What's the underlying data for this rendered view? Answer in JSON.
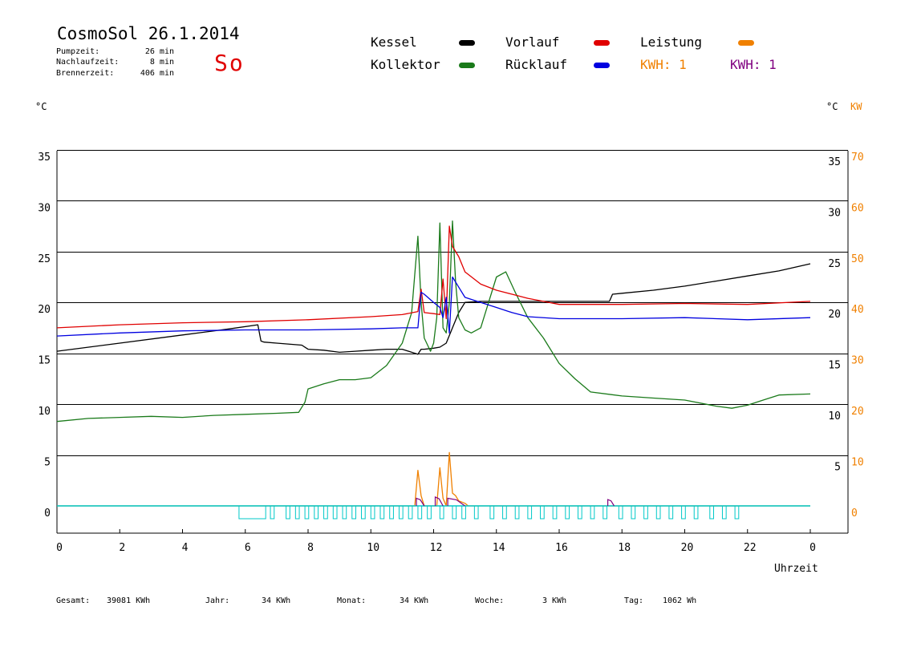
{
  "header": {
    "title": "CosmoSol 26.1.2014",
    "day": "So",
    "day_color": "#e00000",
    "stats": [
      {
        "label": "Pumpzeit:",
        "value": "26 min"
      },
      {
        "label": "Nachlaufzeit:",
        "value": "8 min"
      },
      {
        "label": "Brennerzeit:",
        "value": "406 min"
      }
    ]
  },
  "legend": {
    "kessel": {
      "label": "Kessel",
      "color": "#000000"
    },
    "kollektor": {
      "label": "Kollektor",
      "color": "#1a7a1a"
    },
    "vorlauf": {
      "label": "Vorlauf",
      "color": "#e00000"
    },
    "ruecklauf": {
      "label": "Rücklauf",
      "color": "#0000e0"
    },
    "leistung": {
      "label": "Leistung",
      "color": "#f08000"
    },
    "kwh_orange": {
      "label": "KWH: 1",
      "color": "#f08000"
    },
    "kwh_purple": {
      "label": "KWH: 1",
      "color": "#800080"
    }
  },
  "axes": {
    "left_unit": "°C",
    "right_unit": "°C",
    "kw_unit": "KW",
    "xlabel": "Uhrzeit"
  },
  "footer": [
    {
      "label": "Gesamt:",
      "value": "39081 KWh"
    },
    {
      "label": "Jahr:",
      "value": "34 KWh"
    },
    {
      "label": "Monat:",
      "value": "34 KWh"
    },
    {
      "label": "Woche:",
      "value": "3 KWh"
    },
    {
      "label": "Tag:",
      "value": "1062 Wh"
    }
  ],
  "chart_data": {
    "type": "line",
    "xlim": [
      0,
      24
    ],
    "ylim": [
      -2,
      36.5
    ],
    "y_ticks_left": [
      "0",
      "5",
      "10",
      "15",
      "20",
      "25",
      "30",
      "35"
    ],
    "y_ticks_right_c": [
      "5",
      "10",
      "15",
      "20",
      "25",
      "30",
      "35"
    ],
    "y_ticks_right_kw": [
      "0",
      "10",
      "20",
      "30",
      "40",
      "50",
      "60",
      "70"
    ],
    "x_ticks": [
      "0",
      "2",
      "4",
      "6",
      "8",
      "10",
      "12",
      "14",
      "16",
      "18",
      "20",
      "22",
      "0"
    ],
    "grid": true,
    "series": [
      {
        "name": "Kessel",
        "color": "#000000",
        "x": [
          0,
          2,
          4,
          5.5,
          6.4,
          6.5,
          6.6,
          7,
          7.8,
          8,
          8.5,
          9,
          9.5,
          10,
          10.5,
          11,
          11.5,
          11.6,
          11.7,
          12,
          12.2,
          12.4,
          12.6,
          12.8,
          13,
          13.5,
          14,
          15,
          16,
          17,
          17.6,
          17.7,
          18,
          19,
          20,
          21,
          22,
          23,
          24
        ],
        "y": [
          15.2,
          16.0,
          16.8,
          17.4,
          17.8,
          16.2,
          16.1,
          16.0,
          15.8,
          15.4,
          15.3,
          15.1,
          15.2,
          15.3,
          15.4,
          15.4,
          14.9,
          15.4,
          15.4,
          15.5,
          15.6,
          16.0,
          17.5,
          19.0,
          20.0,
          20.1,
          20.1,
          20.1,
          20.1,
          20.1,
          20.1,
          20.8,
          20.9,
          21.2,
          21.6,
          22.1,
          22.6,
          23.1,
          23.8
        ]
      },
      {
        "name": "Kollektor",
        "color": "#1a7a1a",
        "x": [
          0,
          1,
          2,
          3,
          4,
          5,
          6,
          7,
          7.7,
          7.9,
          8,
          8.5,
          9,
          9.5,
          10,
          10.5,
          11,
          11.3,
          11.5,
          11.6,
          11.7,
          11.9,
          12,
          12.1,
          12.2,
          12.3,
          12.4,
          12.5,
          12.6,
          12.7,
          12.8,
          13,
          13.2,
          13.5,
          14,
          14.3,
          14.6,
          15,
          15.5,
          16,
          16.5,
          17,
          18,
          19,
          20,
          21,
          21.5,
          22,
          22.5,
          23,
          24
        ],
        "y": [
          8.3,
          8.6,
          8.7,
          8.8,
          8.7,
          8.9,
          9.0,
          9.1,
          9.2,
          10.2,
          11.5,
          12.0,
          12.4,
          12.4,
          12.6,
          13.8,
          16.0,
          19.0,
          26.5,
          20.0,
          16.5,
          15.2,
          16.0,
          18.5,
          27.8,
          17.5,
          17.0,
          20.0,
          28.0,
          22.0,
          18.5,
          17.3,
          17.0,
          17.5,
          22.5,
          23.0,
          21.0,
          18.5,
          16.5,
          14.0,
          12.5,
          11.2,
          10.8,
          10.6,
          10.4,
          9.8,
          9.6,
          9.9,
          10.4,
          10.9,
          11.0
        ]
      },
      {
        "name": "Vorlauf",
        "color": "#e00000",
        "x": [
          0,
          2,
          4,
          6,
          8,
          10,
          11,
          11.5,
          11.6,
          11.7,
          12,
          12.2,
          12.3,
          12.4,
          12.5,
          12.6,
          12.8,
          13,
          13.5,
          14,
          14.5,
          15,
          15.5,
          16,
          18,
          20,
          22,
          24
        ],
        "y": [
          17.5,
          17.8,
          18.0,
          18.1,
          18.3,
          18.6,
          18.8,
          19.1,
          21.3,
          19.0,
          18.9,
          18.8,
          22.3,
          18.4,
          27.5,
          25.5,
          24.5,
          23.0,
          21.8,
          21.2,
          20.8,
          20.4,
          20.1,
          19.8,
          19.8,
          19.9,
          19.8,
          20.1
        ]
      },
      {
        "name": "Rücklauf",
        "color": "#0000e0",
        "x": [
          0,
          2,
          4,
          6,
          8,
          10,
          11,
          11.5,
          11.6,
          11.7,
          12,
          12.2,
          12.3,
          12.4,
          12.5,
          12.6,
          12.8,
          13,
          13.5,
          14,
          14.5,
          15,
          16,
          18,
          20,
          22,
          24
        ],
        "y": [
          16.7,
          17.0,
          17.2,
          17.3,
          17.3,
          17.4,
          17.5,
          17.5,
          21.0,
          20.8,
          20.0,
          19.5,
          18.5,
          20.5,
          17.0,
          22.5,
          21.5,
          20.5,
          20.0,
          19.5,
          19.0,
          18.6,
          18.4,
          18.4,
          18.5,
          18.3,
          18.5
        ]
      },
      {
        "name": "Leistung",
        "color": "#f08000",
        "unit": "KW",
        "x": [
          0,
          11.4,
          11.5,
          11.6,
          11.7,
          11.8,
          12.1,
          12.2,
          12.3,
          12.4,
          12.5,
          12.6,
          12.7,
          12.8,
          13.0,
          13.1,
          24
        ],
        "y": [
          0,
          0,
          7.0,
          2.0,
          0,
          0,
          0,
          7.5,
          1.5,
          0,
          10.5,
          2.5,
          2.0,
          1.0,
          0.5,
          0,
          0
        ]
      },
      {
        "name": "Pumpe",
        "color": "#00c8c8",
        "x": [
          0,
          24
        ],
        "y": [
          0,
          0
        ]
      }
    ]
  }
}
